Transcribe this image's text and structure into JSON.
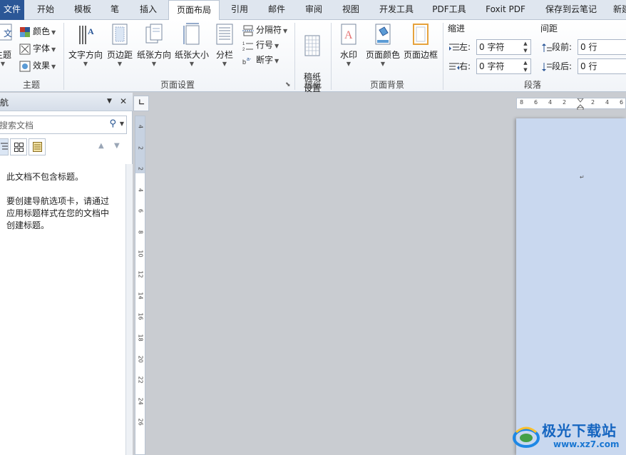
{
  "tabs": [
    "文件",
    "开始",
    "模板",
    "笔",
    "插入",
    "页面布局",
    "引用",
    "邮件",
    "审阅",
    "视图",
    "开发工具",
    "PDF工具",
    "Foxit PDF",
    "保存到云笔记",
    "新建"
  ],
  "active_tab": "页面布局",
  "theme_group": {
    "label": "主题",
    "theme_button": "主题",
    "colors": "颜色",
    "fonts": "字体",
    "effects": "效果"
  },
  "page_setup_group": {
    "label": "页面设置",
    "text_direction": "文字方向",
    "margins": "页边距",
    "orientation": "纸张方向",
    "size": "纸张大小",
    "columns": "分栏",
    "breaks": "分隔符",
    "line_numbers": "行号",
    "hyphenation": "断字"
  },
  "draft_group": {
    "label": "稿纸",
    "draft_settings": "稿纸\n设置"
  },
  "background_group": {
    "label": "页面背景",
    "watermark": "水印",
    "page_color": "页面颜色",
    "page_borders": "页面边框"
  },
  "paragraph_group": {
    "label": "段落",
    "indent_title": "缩进",
    "indent_left_label": "左:",
    "indent_left_value": "0 字符",
    "indent_right_label": "右:",
    "indent_right_value": "0 字符",
    "spacing_title": "间距",
    "spacing_before_label": "段前:",
    "spacing_before_value": "0 行",
    "spacing_after_label": "段后:",
    "spacing_after_value": "0 行"
  },
  "navigation": {
    "title": "航",
    "search_placeholder": "搜索文档",
    "message_1": "此文档不包含标题。",
    "message_2_line1": "要创建导航选项卡，请通过",
    "message_2_line2": "应用标题样式在您的文档中",
    "message_2_line3": "创建标题。"
  },
  "vertical_ruler_ticks": [
    "4",
    "2",
    "2",
    "4",
    "6",
    "8",
    "10",
    "12",
    "14",
    "16",
    "18",
    "20",
    "22",
    "24",
    "26"
  ],
  "horizontal_ruler_ticks": [
    "8",
    "6",
    "4",
    "2",
    "2",
    "4",
    "6"
  ],
  "watermark": {
    "name": "极光下载站",
    "url": "www.xz7.com"
  }
}
